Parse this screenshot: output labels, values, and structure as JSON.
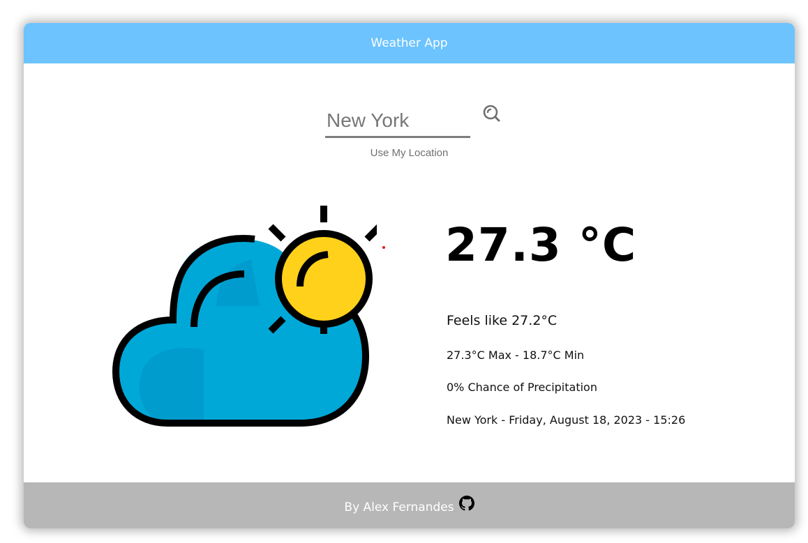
{
  "header": {
    "title": "Weather App"
  },
  "search": {
    "value": "New York",
    "placeholder": "",
    "icon": "search-icon"
  },
  "location_button": {
    "label": "Use My Location"
  },
  "weather": {
    "icon": "partly-cloudy-icon",
    "temperature": "27.3 °C",
    "feels_like": "Feels like 27.2°C",
    "max_min": "27.3°C Max - 18.7°C Min",
    "precipitation": "0% Chance of Precipitation",
    "location_datetime": "New York - Friday, August 18, 2023 - 15:26"
  },
  "footer": {
    "credit": "By Alex Fernandes",
    "icon": "github-icon"
  },
  "colors": {
    "header_bg": "#6cc3fe",
    "footer_bg": "#b7b7b7",
    "cloud": "#00a8d8",
    "cloud_shade": "#009ccd",
    "sun": "#ffd11a"
  }
}
